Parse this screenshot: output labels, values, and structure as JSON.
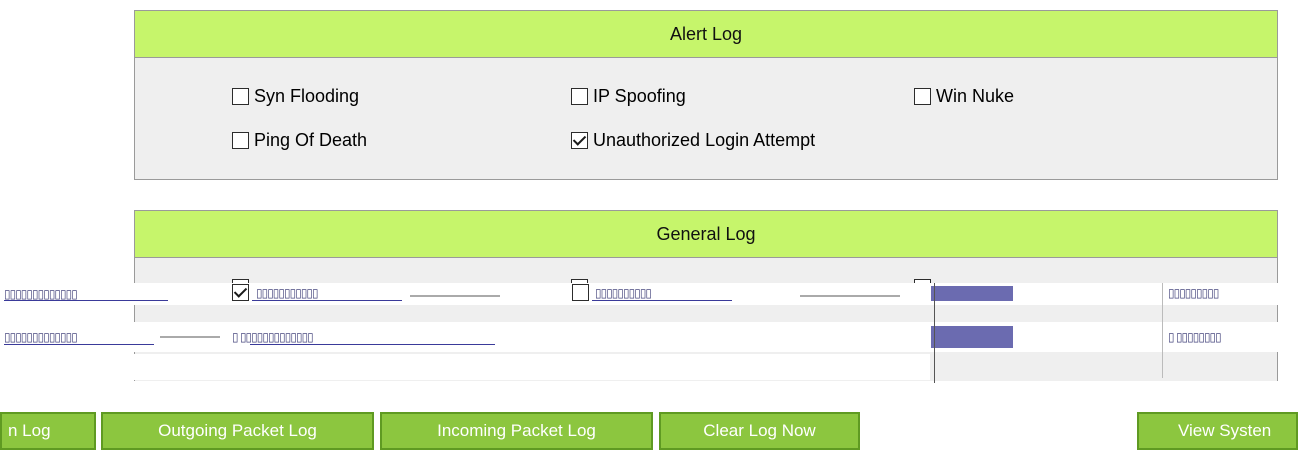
{
  "alert_log": {
    "title": "Alert Log",
    "options": [
      {
        "label": "Syn Flooding",
        "checked": false
      },
      {
        "label": "IP Spoofing",
        "checked": false
      },
      {
        "label": "Win Nuke",
        "checked": false
      },
      {
        "label": "Ping Of Death",
        "checked": false
      },
      {
        "label": "Unauthorized Login Attempt",
        "checked": true
      }
    ]
  },
  "general_log": {
    "title": "General Log"
  },
  "buttons": {
    "system_log": "n Log",
    "outgoing_packet_log": "Outgoing Packet Log",
    "incoming_packet_log": "Incoming Packet Log",
    "clear_log_now": "Clear Log Now",
    "view_system": "View Systen"
  },
  "colors": {
    "header_bg": "#c6f56b",
    "panel_bg": "#efefef",
    "button_bg": "#8cc63f"
  }
}
